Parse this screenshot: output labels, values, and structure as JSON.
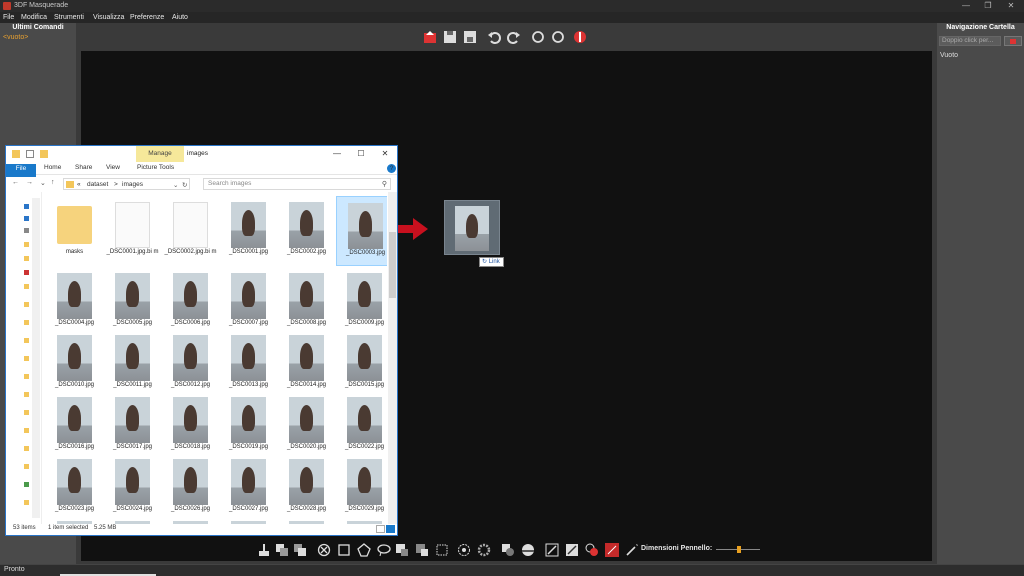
{
  "app": {
    "title": "3DF Masquerade",
    "window_buttons": [
      "—",
      "❐",
      "✕"
    ]
  },
  "menu": [
    "File",
    "Modifica",
    "Strumenti",
    "Visualizza",
    "Preferenze",
    "Aiuto"
  ],
  "left_panel": {
    "title": "Ultimi Comandi",
    "empty_text": "<vuoto>"
  },
  "right_panel": {
    "title": "Navigazione Cartella",
    "search_placeholder": "Doppio click per...",
    "empty_text": "Vuoto"
  },
  "toolbar_top": {
    "icons": [
      "open-icon",
      "save-icon",
      "save-as-icon",
      "undo-icon",
      "redo-icon",
      "rotate-left-icon",
      "rotate-right-icon",
      "mask-toggle-icon"
    ]
  },
  "toolbar_bottom": {
    "icons": [
      "brush-icon",
      "add-mask-icon",
      "subtract-mask-icon",
      "clear-icon",
      "rectangle-icon",
      "polygon-icon",
      "lasso-icon",
      "grow-icon",
      "shrink-icon",
      "feather-icon",
      "smart-select-icon",
      "settings-icon",
      "invert-icon",
      "sphere-icon",
      "line-icon",
      "edit-icon",
      "color-pick-icon",
      "red-mode-icon",
      "wand-icon"
    ],
    "brush_size_label": "Dimensioni Pennello:",
    "brush_size_level": 0.5
  },
  "status": {
    "text": "Pronto"
  },
  "explorer": {
    "manage_tab": "Manage",
    "folder_name": "images",
    "window_controls": [
      "—",
      "☐",
      "✕"
    ],
    "ribbon_tabs": [
      "File",
      "Home",
      "Share",
      "View",
      "Picture Tools"
    ],
    "breadcrumb": [
      "«",
      "dataset",
      ">",
      "images"
    ],
    "search_placeholder": "Search images",
    "items": [
      {
        "name": "masks",
        "kind": "folder"
      },
      {
        "name": "_DSC0001.jpg.bi m",
        "kind": "doc"
      },
      {
        "name": "_DSC0002.jpg.bi m",
        "kind": "doc"
      },
      {
        "name": "_DSC0001.jpg",
        "kind": "photo"
      },
      {
        "name": "_DSC0002.jpg",
        "kind": "photo"
      },
      {
        "name": "_DSC0003.jpg",
        "kind": "photo",
        "selected": true
      },
      {
        "name": "_DSC0004.jpg",
        "kind": "photo"
      },
      {
        "name": "_DSC0005.jpg",
        "kind": "photo"
      },
      {
        "name": "_DSC0006.jpg",
        "kind": "photo"
      },
      {
        "name": "_DSC0007.jpg",
        "kind": "photo"
      },
      {
        "name": "_DSC0008.jpg",
        "kind": "photo"
      },
      {
        "name": "_DSC0009.jpg",
        "kind": "photo"
      },
      {
        "name": "_DSC0010.jpg",
        "kind": "photo"
      },
      {
        "name": "_DSC0011.jpg",
        "kind": "photo"
      },
      {
        "name": "_DSC0012.jpg",
        "kind": "photo"
      },
      {
        "name": "_DSC0013.jpg",
        "kind": "photo"
      },
      {
        "name": "_DSC0014.jpg",
        "kind": "photo"
      },
      {
        "name": "_DSC0015.jpg",
        "kind": "photo"
      },
      {
        "name": "_DSC0016.jpg",
        "kind": "photo"
      },
      {
        "name": "_DSC0017.jpg",
        "kind": "photo"
      },
      {
        "name": "_DSC0018.jpg",
        "kind": "photo"
      },
      {
        "name": "_DSC0019.jpg",
        "kind": "photo"
      },
      {
        "name": "_DSC0020.jpg",
        "kind": "photo"
      },
      {
        "name": "_DSC0022.jpg",
        "kind": "photo"
      },
      {
        "name": "_DSC0023.jpg",
        "kind": "photo"
      },
      {
        "name": "_DSC0024.jpg",
        "kind": "photo"
      },
      {
        "name": "_DSC0026.jpg",
        "kind": "photo"
      },
      {
        "name": "_DSC0027.jpg",
        "kind": "photo"
      },
      {
        "name": "_DSC0028.jpg",
        "kind": "photo"
      },
      {
        "name": "_DSC0029.jpg",
        "kind": "photo"
      }
    ],
    "status_count": "53 items",
    "status_selected": "1 item selected",
    "status_size": "5.25 MB"
  },
  "drag": {
    "tooltip": "Link",
    "arrow_color": "#c8101e"
  },
  "colors": {
    "accent_orange": "#e8a030",
    "explorer_blue": "#1979ca",
    "manage_yellow": "#f6e89a",
    "red_icon": "#d33333"
  }
}
